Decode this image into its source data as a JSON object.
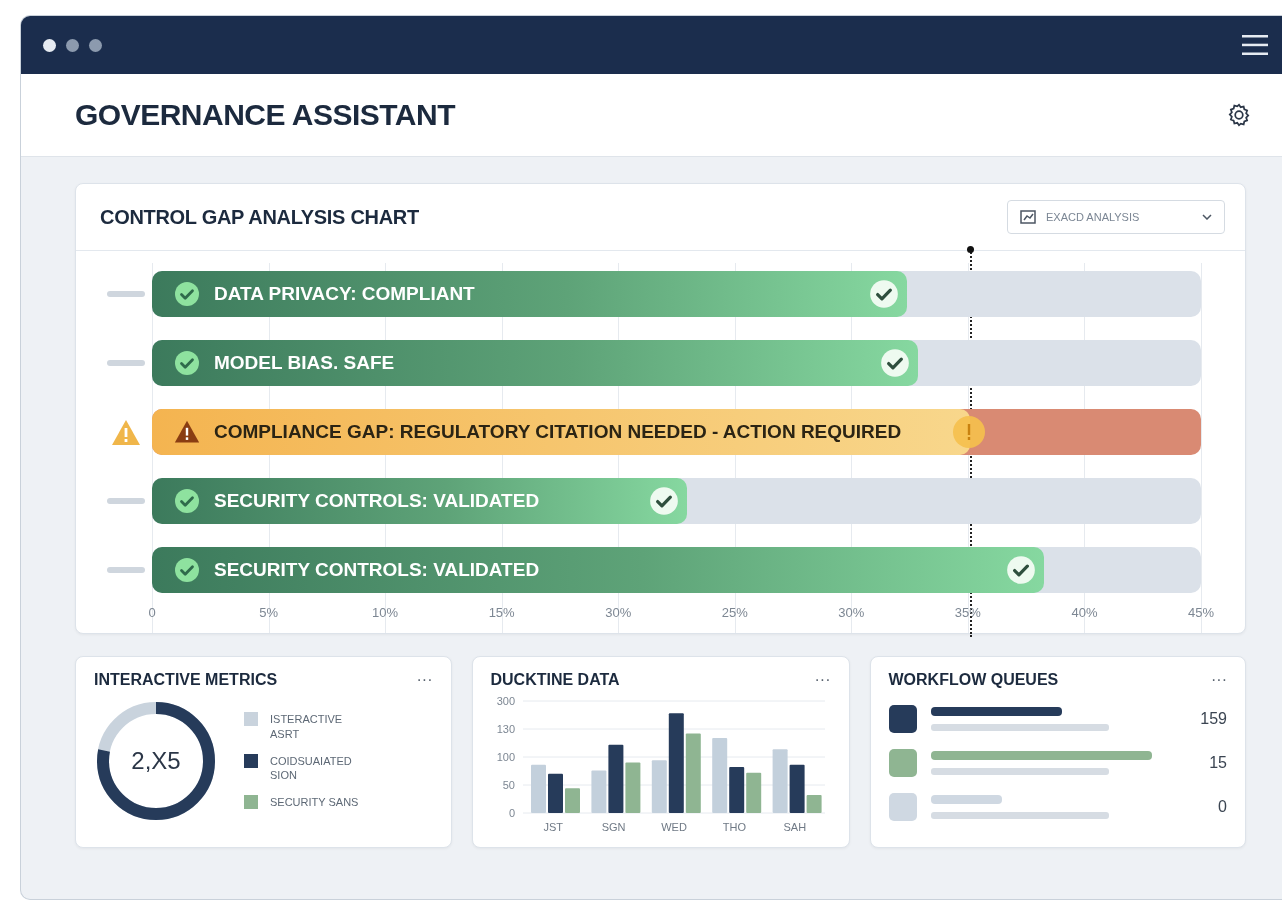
{
  "window": {
    "title": "GOVERNANCE ASSISTANT"
  },
  "gap_chart": {
    "title": "CONTROL GAP ANALYSIS CHART",
    "dropdown": {
      "value": "EXACD ANALYSIS"
    },
    "rows": [
      {
        "kind": "ok",
        "label": "DATA PRIVACY: COMPLIANT",
        "level": 0.72
      },
      {
        "kind": "ok",
        "label": "MODEL BIAS. SAFE",
        "level": 0.73
      },
      {
        "kind": "gap",
        "label": "COMPLIANCE GAP: REGULATORY CITATION NEEDED - ACTION REQUIRED",
        "level": 0.78
      },
      {
        "kind": "ok",
        "label": "SECURITY CONTROLS: VALIDATED",
        "level": 0.51
      },
      {
        "kind": "ok",
        "label": "SECURITY CONTROLS: VALIDATED",
        "level": 0.85
      }
    ],
    "axis_labels": [
      "0",
      "5%",
      "10%",
      "15%",
      "30%",
      "25%",
      "30%",
      "35%",
      "40%",
      "45%"
    ]
  },
  "metrics": {
    "title": "INTERACTIVE METRICS",
    "menu": "···",
    "center": "2,X5",
    "legend": [
      {
        "label": "ISTERACTIVE ASRT",
        "color": "#c9d3dd"
      },
      {
        "label": "COIDSUAIATED SION",
        "color": "#263b5a"
      },
      {
        "label": "SECURITY SANS",
        "color": "#8fb592"
      }
    ]
  },
  "realtime": {
    "title": "DUCKTINE DATA",
    "menu": "···",
    "x_axis_labels": [
      "JST",
      "SGN",
      "WED",
      "THO",
      "SAH"
    ],
    "y_axis_labels": [
      "300",
      "130",
      "100",
      "50",
      "0"
    ]
  },
  "queues": {
    "title": "WORKFLOW QUEUES",
    "menu": "···",
    "items": [
      {
        "color": "#263b5a",
        "count": "159"
      },
      {
        "color": "#8fb592",
        "count": "15"
      },
      {
        "color": "#cfd8e2",
        "count": "0"
      }
    ]
  }
}
